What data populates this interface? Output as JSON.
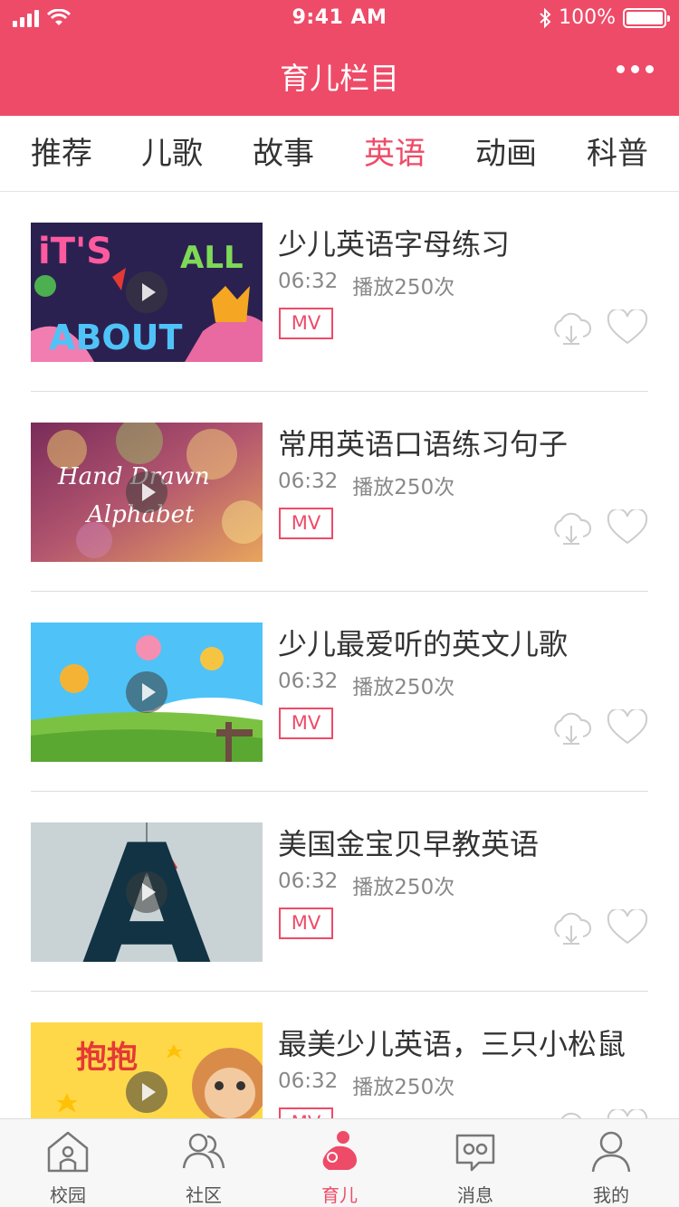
{
  "status_bar": {
    "time": "9:41 AM",
    "battery_percent": "100%",
    "icons": [
      "signal-icon",
      "wifi-icon",
      "bluetooth-icon",
      "battery-icon"
    ]
  },
  "nav": {
    "title": "育儿栏目",
    "more_icon": "more-dots-icon"
  },
  "tabs": [
    {
      "label": "推荐",
      "active": false
    },
    {
      "label": "儿歌",
      "active": false
    },
    {
      "label": "故事",
      "active": false
    },
    {
      "label": "英语",
      "active": true
    },
    {
      "label": "动画",
      "active": false
    },
    {
      "label": "科普",
      "active": false
    }
  ],
  "videos": [
    {
      "title": "少儿英语字母练习",
      "duration": "06:32",
      "plays": "播放250次",
      "tag": "MV",
      "thumb_text": [
        "iT'S",
        "ALL",
        "ABOUT"
      ]
    },
    {
      "title": "常用英语口语练习句子",
      "duration": "06:32",
      "plays": "播放250次",
      "tag": "MV",
      "thumb_text": [
        "Hand Drawn",
        "Alphabet"
      ]
    },
    {
      "title": "少儿最爱听的英文儿歌",
      "duration": "06:32",
      "plays": "播放250次",
      "tag": "MV",
      "thumb_text": []
    },
    {
      "title": "美国金宝贝早教英语",
      "duration": "06:32",
      "plays": "播放250次",
      "tag": "MV",
      "thumb_text": [
        "A"
      ]
    },
    {
      "title": "最美少儿英语，三只小松鼠",
      "duration": "06:32",
      "plays": "播放250次",
      "tag": "MV",
      "thumb_text": [
        "抱抱"
      ]
    }
  ],
  "tabbar": [
    {
      "label": "校园",
      "icon": "school-house-icon",
      "active": false
    },
    {
      "label": "社区",
      "icon": "community-people-icon",
      "active": false
    },
    {
      "label": "育儿",
      "icon": "mother-baby-icon",
      "active": true
    },
    {
      "label": "消息",
      "icon": "message-bubble-icon",
      "active": false
    },
    {
      "label": "我的",
      "icon": "profile-person-icon",
      "active": false
    }
  ],
  "colors": {
    "brand": "#ee4b68",
    "text_primary": "#333333",
    "text_secondary": "#888888",
    "icon_gray": "#cccccc"
  }
}
